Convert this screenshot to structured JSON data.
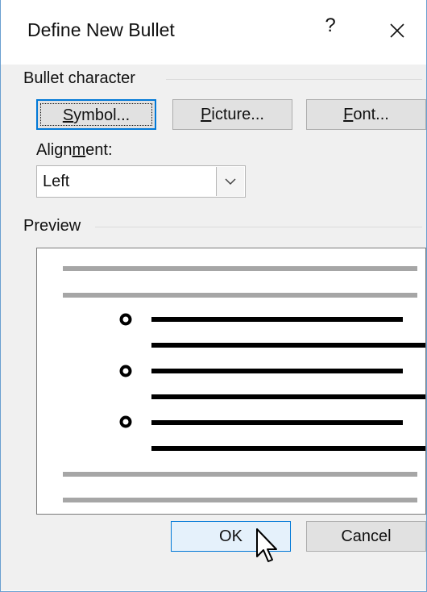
{
  "window": {
    "title": "Define New Bullet",
    "help_label": "?"
  },
  "bullet_character": {
    "group_label": "Bullet character",
    "symbol_button": {
      "before": "",
      "accel": "S",
      "after": "ymbol..."
    },
    "picture_button": {
      "before": "",
      "accel": "P",
      "after": "icture..."
    },
    "font_button": {
      "before": "",
      "accel": "F",
      "after": "ont..."
    }
  },
  "alignment": {
    "label_before": "Align",
    "label_accel": "m",
    "label_after": "ent:",
    "selected": "Left"
  },
  "preview": {
    "group_label": "Preview",
    "bullet_levels": 3
  },
  "footer": {
    "ok_label": "OK",
    "cancel_label": "Cancel"
  },
  "colors": {
    "accent": "#0078d7",
    "dialog_background": "#f0f0f0",
    "preview_gray_line": "#a6a6a6",
    "preview_black_line": "#000000"
  },
  "icons": [
    "close-icon",
    "chevron-down-icon",
    "pointer-cursor-icon",
    "hollow-bullet-icon"
  ]
}
